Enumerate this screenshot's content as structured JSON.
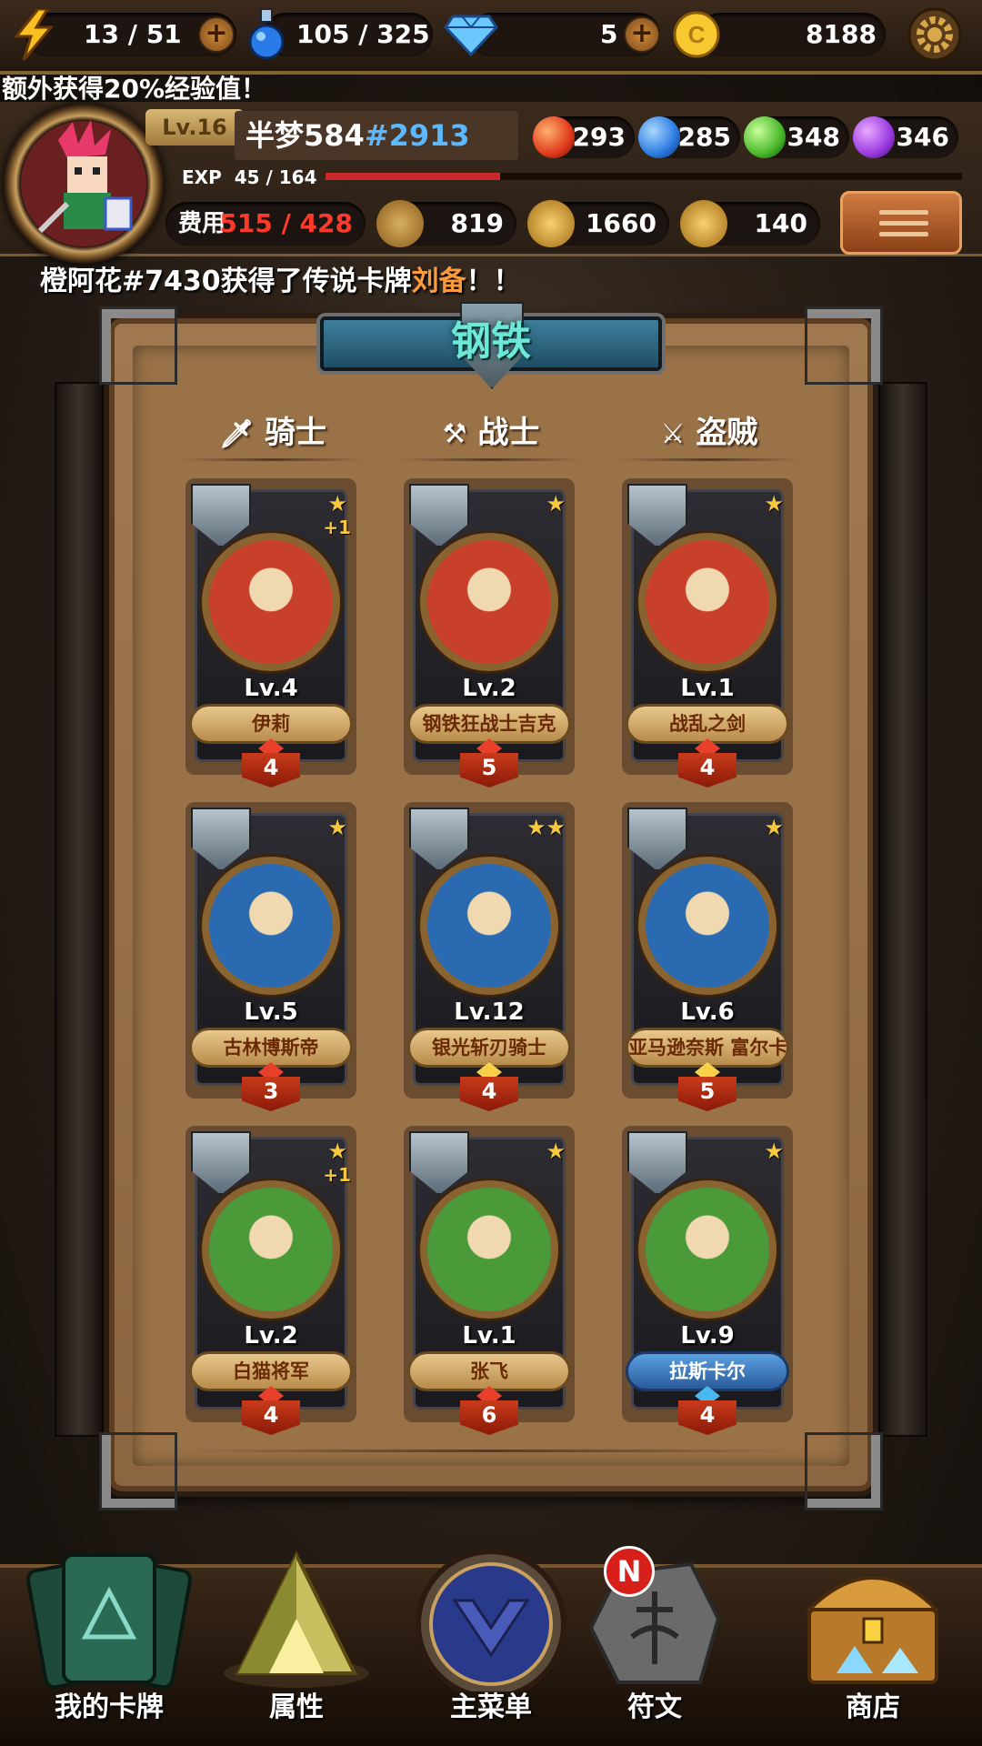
{
  "resources": [
    {
      "name": "energy",
      "icon": "lightning-icon",
      "value": "13 / 51"
    },
    {
      "name": "potion",
      "icon": "potion-icon",
      "value": "105 / 325"
    },
    {
      "name": "diamond",
      "icon": "diamond-icon",
      "value": "5"
    },
    {
      "name": "gold",
      "icon": "coin-icon",
      "value": "8188"
    }
  ],
  "bonus_banner": "额外获得20%经验值！",
  "player": {
    "level": "Lv.16",
    "name": "半梦584",
    "tag": "#2913",
    "exp_label": "EXP",
    "exp_value": "45 / 164",
    "exp_fraction": 0.274,
    "orbs": [
      {
        "icon": "fire-orb-icon",
        "value": "293",
        "color": "#e03a1a"
      },
      {
        "icon": "water-orb-icon",
        "value": "285",
        "color": "#2a7ae0"
      },
      {
        "icon": "nature-orb-icon",
        "value": "348",
        "color": "#4ab82a"
      },
      {
        "icon": "arcane-orb-icon",
        "value": "346",
        "color": "#9a3ae0"
      }
    ],
    "cost_label": "费用",
    "cost_value": "515 / 428",
    "attack": "819",
    "health": "1660",
    "heal": "140"
  },
  "announcement": {
    "prefix": "橙阿花#7430获得了传说卡牌",
    "highlight": "刘备",
    "suffix": "！！"
  },
  "deck_title": "钢铁",
  "columns": [
    "骑士",
    "战士",
    "盗贼"
  ],
  "cards": [
    {
      "name": "伊莉",
      "level": "Lv.4",
      "stars": "★",
      "plus": "+1",
      "cost": "4",
      "bg": "#c8402a",
      "banner": "gold",
      "gem": "red"
    },
    {
      "name": "钢铁狂战士吉克",
      "level": "Lv.2",
      "stars": "★",
      "plus": "",
      "cost": "5",
      "bg": "#c8402a",
      "banner": "gold",
      "gem": "red"
    },
    {
      "name": "战乱之剑",
      "level": "Lv.1",
      "stars": "★",
      "plus": "",
      "cost": "4",
      "bg": "#c8402a",
      "banner": "gold",
      "gem": "red"
    },
    {
      "name": "古林博斯帝",
      "level": "Lv.5",
      "stars": "★",
      "plus": "",
      "cost": "3",
      "bg": "#2a6ab0",
      "banner": "gold",
      "gem": "red"
    },
    {
      "name": "银光斩刃骑士",
      "level": "Lv.12",
      "stars": "★★",
      "plus": "",
      "cost": "4",
      "bg": "#2a6ab0",
      "banner": "gold",
      "gem": "gold"
    },
    {
      "name": "亚马逊奈斯 富尔卡",
      "level": "Lv.6",
      "stars": "★",
      "plus": "",
      "cost": "5",
      "bg": "#2a6ab0",
      "banner": "gold",
      "gem": "gold"
    },
    {
      "name": "白猫将军",
      "level": "Lv.2",
      "stars": "★",
      "plus": "+1",
      "cost": "4",
      "bg": "#4a9a3a",
      "banner": "gold",
      "gem": "red"
    },
    {
      "name": "张飞",
      "level": "Lv.1",
      "stars": "★",
      "plus": "",
      "cost": "6",
      "bg": "#4a9a3a",
      "banner": "gold",
      "gem": "red"
    },
    {
      "name": "拉斯卡尔",
      "level": "Lv.9",
      "stars": "★",
      "plus": "",
      "cost": "4",
      "bg": "#4a9a3a",
      "banner": "blue",
      "gem": "blue"
    }
  ],
  "nav": [
    {
      "label": "我的卡牌",
      "icon": "cards-icon"
    },
    {
      "label": "属性",
      "icon": "triangle-crystal-icon"
    },
    {
      "label": "主菜单",
      "icon": "emblem-icon"
    },
    {
      "label": "符文",
      "icon": "rune-stone-icon",
      "badge": "N"
    },
    {
      "label": "商店",
      "icon": "treasure-chest-icon"
    }
  ]
}
